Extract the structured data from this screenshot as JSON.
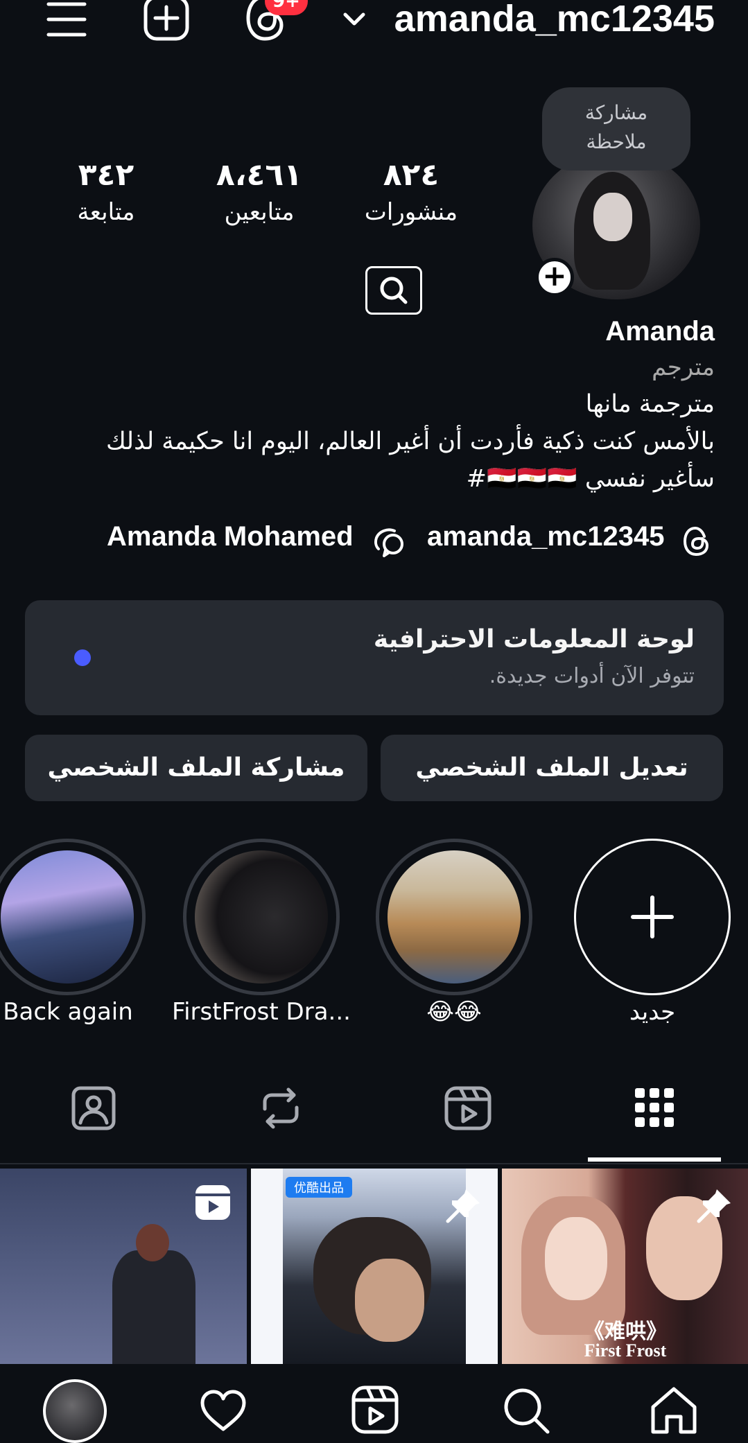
{
  "header": {
    "username": "amanda_mc12345",
    "threads_badge": "9+"
  },
  "profile": {
    "note": "مشاركة ملاحظة",
    "stats": [
      {
        "value": "٨٢٤",
        "label": "منشورات"
      },
      {
        "value": "٨،٤٦١",
        "label": "متابعين"
      },
      {
        "value": "٣٤٢",
        "label": "متابعة"
      }
    ],
    "name": "Amanda",
    "category": "مترجم",
    "bio_lines": [
      "مترجمة مانها",
      "بالأمس كنت ذكية فأردت أن أغير العالم، اليوم انا حكيمة لذلك",
      "سأغير نفسي 🇪🇬🇪🇬🇪🇬#"
    ],
    "threads_link": "amanda_mc12345",
    "messenger_link": "Amanda Mohamed"
  },
  "dashboard": {
    "title": "لوحة المعلومات الاحترافية",
    "subtitle": "تتوفر الآن أدوات جديدة.",
    "dot_color": "#4a5cff"
  },
  "buttons": {
    "edit_profile": "تعديل الملف الشخصي",
    "share_profile": "مشاركة الملف الشخصي"
  },
  "highlights": [
    {
      "label": "جديد"
    },
    {
      "label": "😂😂"
    },
    {
      "label": "FirstFrost Dra..."
    },
    {
      "label": "Back again"
    }
  ],
  "tabs": [
    "grid",
    "reels",
    "reposts",
    "tagged"
  ],
  "grid_posts": [
    {
      "caption": "First Frost",
      "title_overlay": "《难哄》",
      "pinned": true
    },
    {
      "caption": "",
      "title_overlay": "优酷出品",
      "pinned": true
    },
    {
      "caption": "",
      "title_overlay": "",
      "reel": true
    }
  ],
  "bottom_nav": [
    "home-icon",
    "search-icon",
    "reels-icon",
    "heart-icon",
    "profile-avatar"
  ]
}
